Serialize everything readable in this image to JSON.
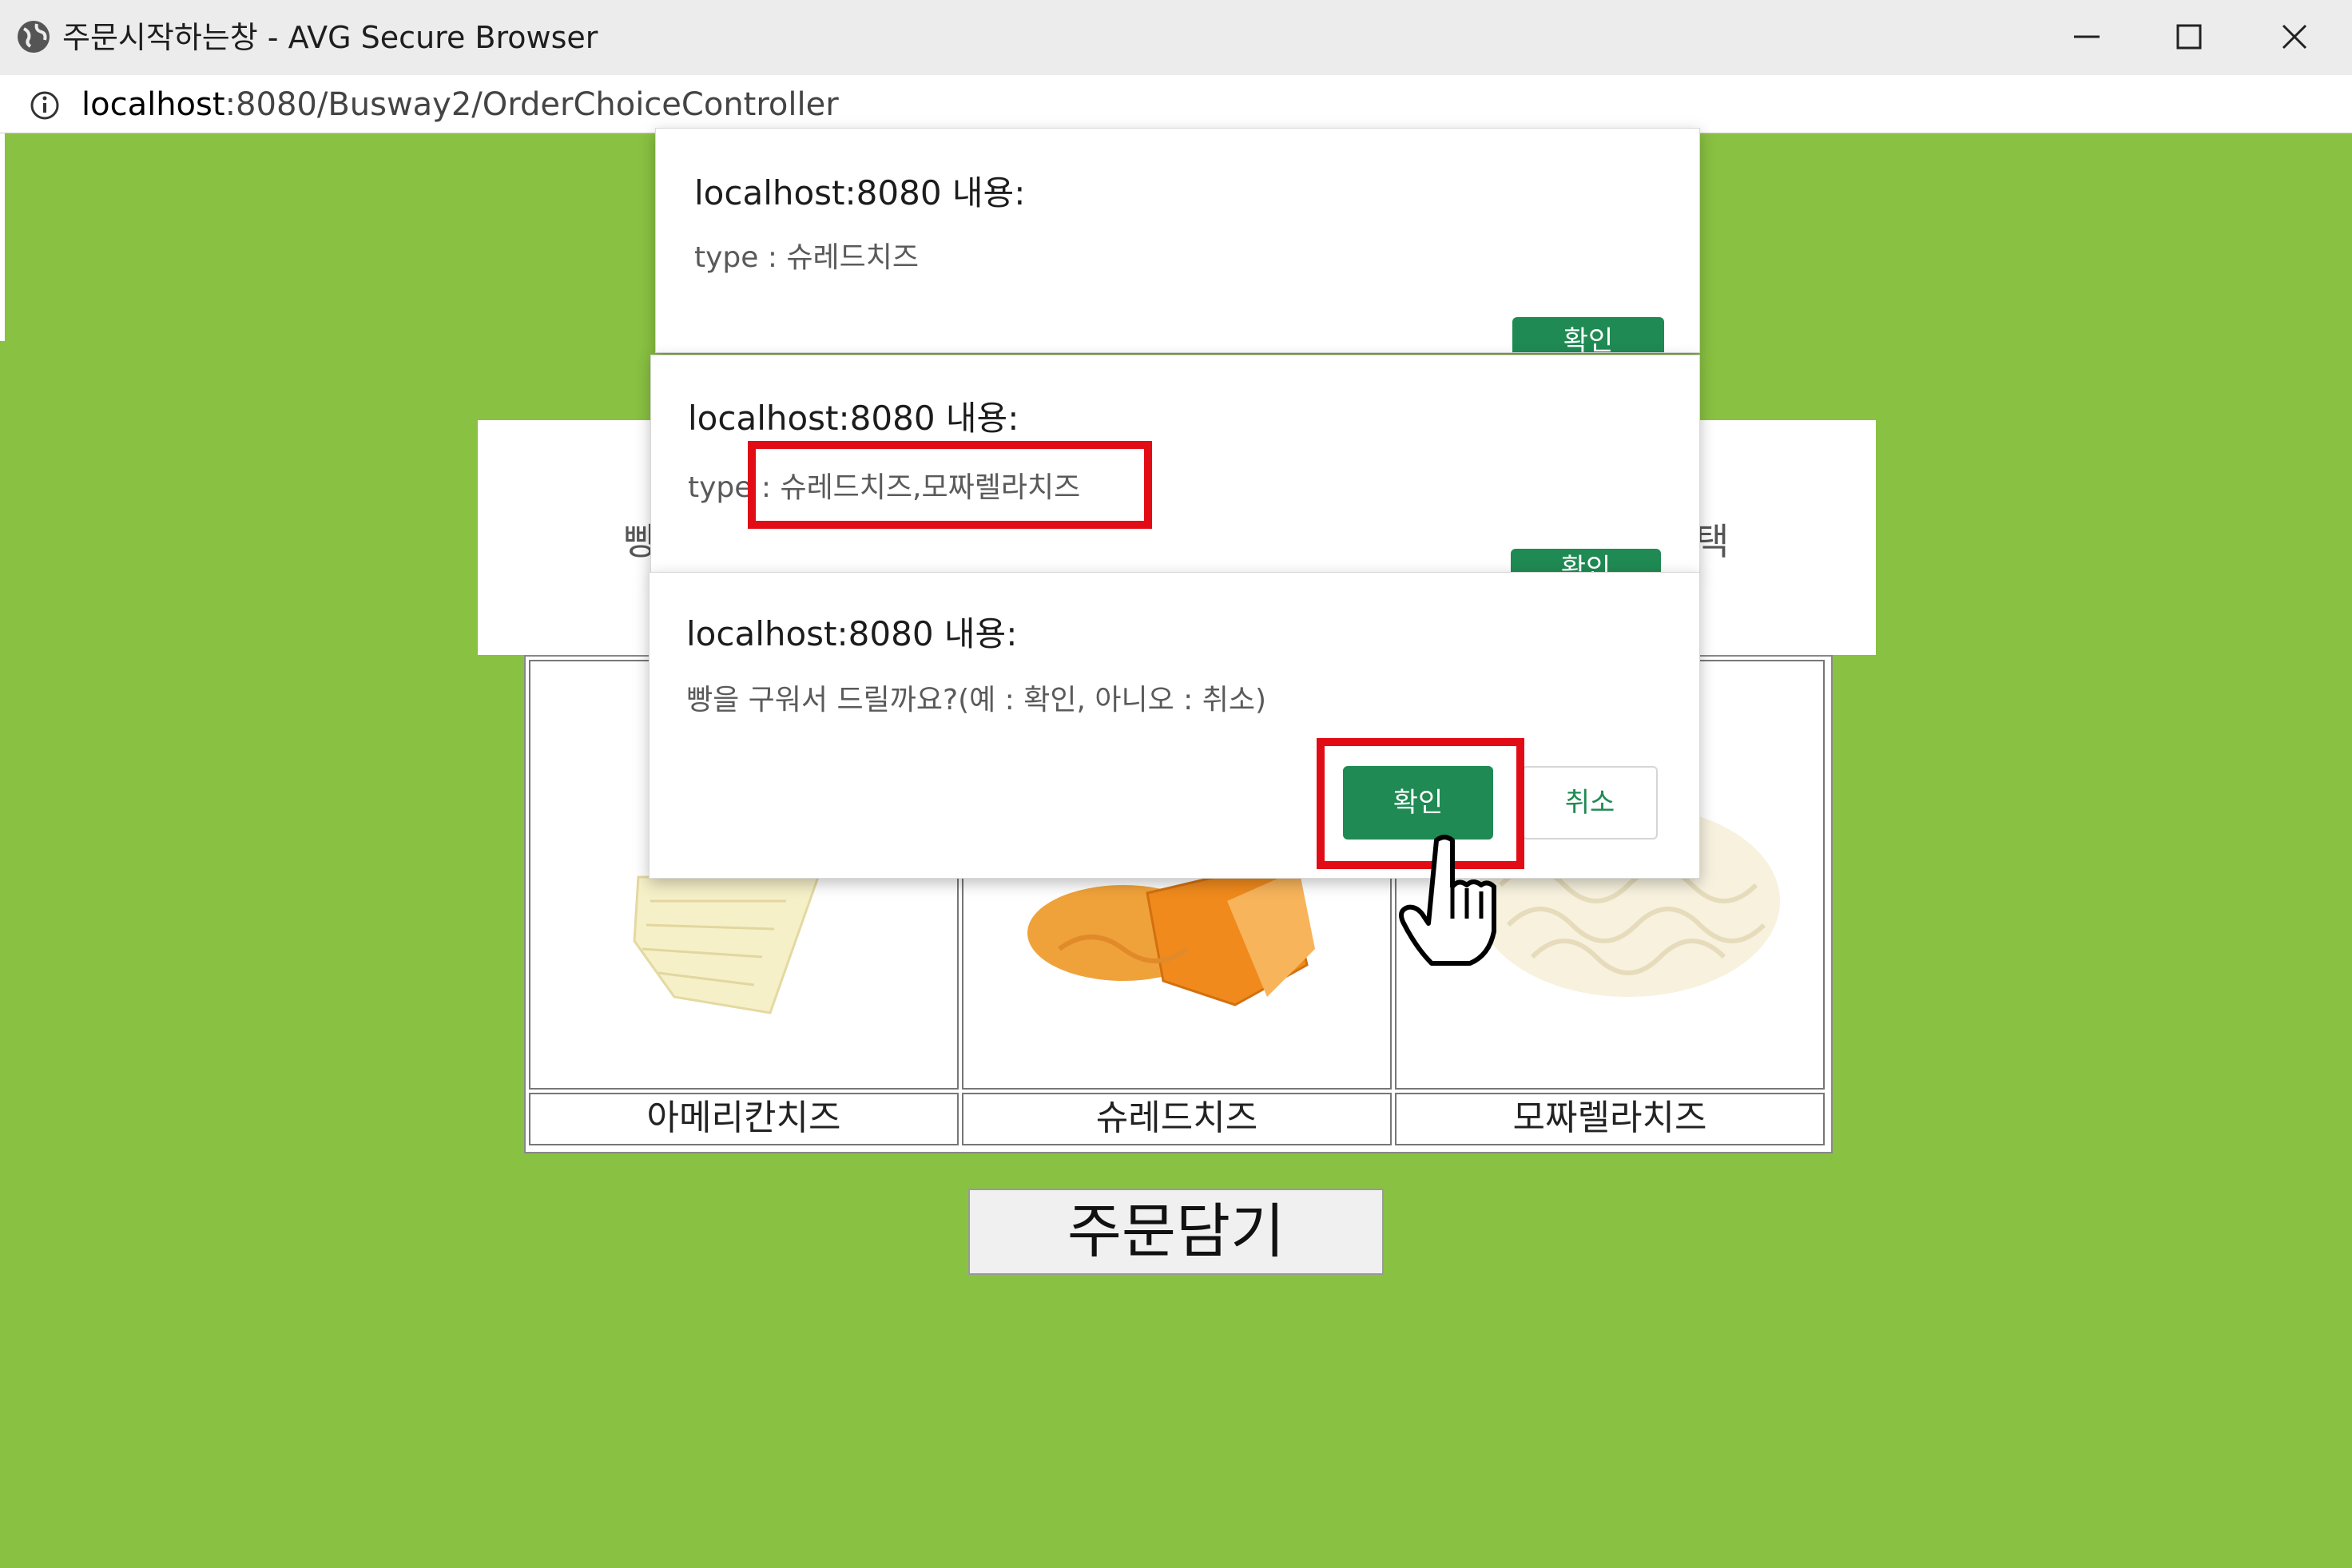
{
  "window": {
    "title": "주문시작하는창 - AVG Secure Browser",
    "url_host": "localhost",
    "url_rest": ":8080/Busway2/OrderChoiceController"
  },
  "page": {
    "behind_left_fragment": "빵",
    "behind_right_fragment": "택",
    "cheese_options": [
      {
        "label": "아메리칸치즈",
        "image": "american-cheese-slices"
      },
      {
        "label": "슈레드치즈",
        "image": "shredded-cheddar"
      },
      {
        "label": "모짜렐라치즈",
        "image": "shredded-mozzarella"
      }
    ],
    "order_button": "주문담기"
  },
  "dialogs": [
    {
      "title": "localhost:8080 내용:",
      "message": "type : 슈레드치즈",
      "ok": "확인"
    },
    {
      "title": "localhost:8080 내용:",
      "message_prefix": "type",
      "message_value": ": 슈레드치즈,모짜렐라치즈",
      "ok": "확인"
    },
    {
      "title": "localhost:8080 내용:",
      "message": "빵을 구워서 드릴까요?(예 : 확인, 아니오 : 취소)",
      "ok": "확인",
      "cancel": "취소"
    }
  ],
  "colors": {
    "page_bg": "#89c142",
    "dialog_button": "#1f8a53",
    "highlight": "#e10c16"
  }
}
